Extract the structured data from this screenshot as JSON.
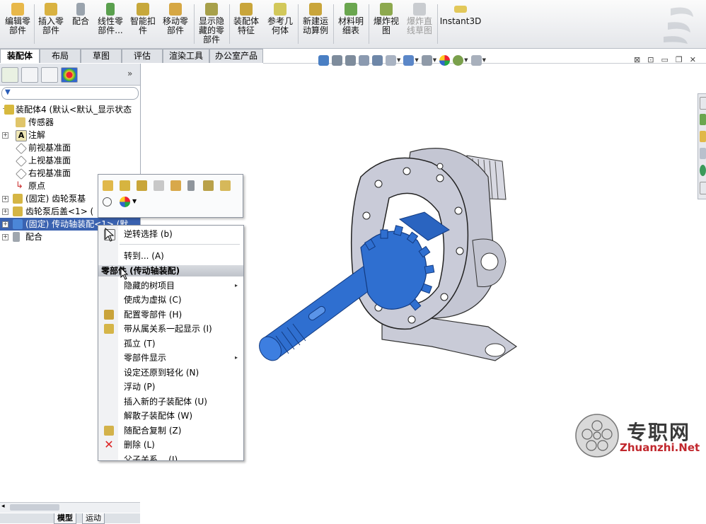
{
  "toolbar": {
    "buttons": [
      {
        "label": "编辑零\n部件",
        "icon": "edit-component-icon"
      },
      {
        "label": "插入零\n部件",
        "icon": "insert-component-icon"
      },
      {
        "label": "配合",
        "icon": "mate-icon"
      },
      {
        "label": "线性零\n部件...",
        "icon": "linear-pattern-icon"
      },
      {
        "label": "智能扣\n件",
        "icon": "smart-fastener-icon"
      },
      {
        "label": "移动零\n部件",
        "icon": "move-component-icon"
      },
      {
        "label": "显示隐\n藏的零\n部件",
        "icon": "show-hidden-icon"
      },
      {
        "label": "装配体\n特征",
        "icon": "assembly-feature-icon"
      },
      {
        "label": "参考几\n何体",
        "icon": "reference-geometry-icon"
      },
      {
        "label": "新建运\n动算例",
        "icon": "motion-study-icon"
      },
      {
        "label": "材料明\n细表",
        "icon": "bom-icon"
      },
      {
        "label": "爆炸视\n图",
        "icon": "exploded-view-icon"
      },
      {
        "label": "爆炸直\n线草图",
        "icon": "explode-line-icon"
      },
      {
        "label": "Instant3D",
        "icon": "instant3d-icon"
      }
    ]
  },
  "command_tabs": [
    "装配体",
    "布局",
    "草图",
    "评估",
    "渲染工具",
    "办公室产品"
  ],
  "tree": {
    "rows": [
      {
        "label": "装配体4  (默认<默认_显示状态",
        "icon": "assembly-icon",
        "expand": "-"
      },
      {
        "label": "传感器",
        "icon": "sensor-icon",
        "expand": ""
      },
      {
        "label": "注解",
        "icon": "annotation-icon",
        "expand": "+"
      },
      {
        "label": "前视基准面",
        "icon": "plane-icon",
        "expand": ""
      },
      {
        "label": "上视基准面",
        "icon": "plane-icon",
        "expand": ""
      },
      {
        "label": "右视基准面",
        "icon": "plane-icon",
        "expand": ""
      },
      {
        "label": "原点",
        "icon": "origin-icon",
        "expand": ""
      },
      {
        "label": "(固定) 齿轮泵基",
        "icon": "part-icon",
        "expand": "+"
      },
      {
        "label": "齿轮泵后盖<1> (",
        "icon": "part-icon",
        "expand": "+"
      },
      {
        "label": "(固定) 传动轴装配<1> (默",
        "icon": "subassembly-icon",
        "expand": "+"
      },
      {
        "label": "配合",
        "icon": "mates-folder-icon",
        "expand": "+"
      }
    ],
    "bottom_tabs": [
      "模型",
      "运动"
    ]
  },
  "context_menu": {
    "items_top": [
      "逆转选择 (b)",
      "转到... (A)"
    ],
    "header": "零部件 (传动轴装配)",
    "items": [
      {
        "label": "隐藏的树项目",
        "submenu": true
      },
      {
        "label": "使成为虚拟 (C)",
        "submenu": false
      },
      {
        "label": "配置零部件 (H)",
        "submenu": false
      },
      {
        "label": "带从属关系一起显示 (I)",
        "submenu": false
      },
      {
        "label": "孤立 (T)",
        "submenu": false
      },
      {
        "label": "零部件显示",
        "submenu": true
      },
      {
        "label": "设定还原到轻化 (N)",
        "submenu": false
      },
      {
        "label": "浮动 (P)",
        "submenu": false
      },
      {
        "label": "插入新的子装配体 (U)",
        "submenu": false
      },
      {
        "label": "解散子装配体 (W)",
        "submenu": false
      },
      {
        "label": "随配合复制 (Z)",
        "submenu": false
      },
      {
        "label": "删除 (L)",
        "submenu": false
      },
      {
        "label": "父子关系... (J)",
        "submenu": false
      }
    ]
  },
  "watermark": {
    "text": "专职网",
    "url": "Zhuanzhi.Net"
  },
  "colors": {
    "selection": "#3a62b0",
    "shaft": "#2f6fd0",
    "housing": "#c8cad6",
    "watermark_url": "#c1272d"
  }
}
